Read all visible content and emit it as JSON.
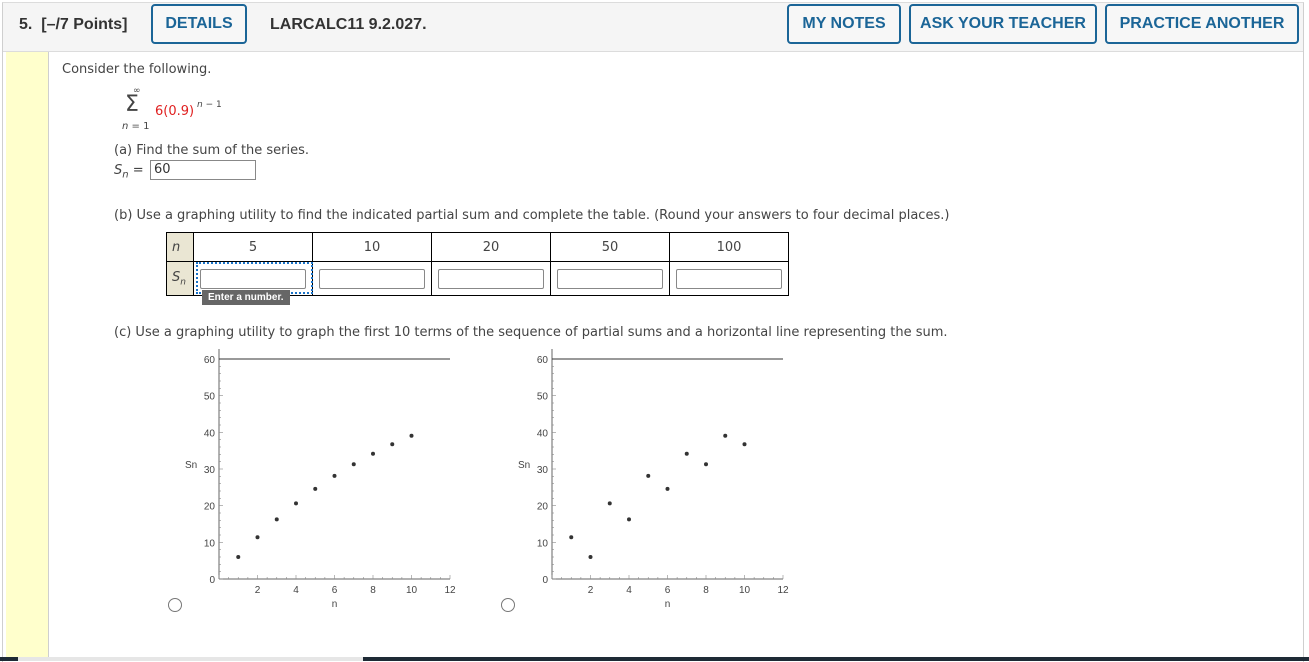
{
  "header": {
    "question_number": "5.",
    "points": "[–/7 Points]",
    "details_label": "DETAILS",
    "question_id": "LARCALC11 9.2.027.",
    "my_notes_label": "MY NOTES",
    "ask_teacher_label": "ASK YOUR TEACHER",
    "practice_another_label": "PRACTICE ANOTHER"
  },
  "colors": {
    "accent": "#1b6597",
    "highlight_red": "#e02020",
    "left_bar": "#ffffcc"
  },
  "problem": {
    "intro": "Consider the following.",
    "series": {
      "upper": "∞",
      "sigma": "Σ",
      "lower": "n = 1",
      "term_coefficient": "6(0.9)",
      "exponent": "n − 1"
    },
    "part_a": {
      "prompt": "(a) Find the sum of the series.",
      "label_var": "S",
      "label_sub": "n",
      "equals": "=",
      "value": "60"
    },
    "part_b": {
      "prompt": "(b) Use a graphing utility to find the indicated partial sum and complete the table. (Round your answers to four decimal places.)",
      "row_header_n": "n",
      "row_header_s": "S",
      "row_header_s_sub": "n",
      "columns": [
        "5",
        "10",
        "20",
        "50",
        "100"
      ],
      "values": [
        "",
        "",
        "",
        "",
        ""
      ],
      "tooltip": "Enter a number."
    },
    "part_c": {
      "prompt": "(c) Use a graphing utility to graph the first 10 terms of the sequence of partial sums and a horizontal line representing the sum."
    }
  },
  "chart_data": [
    {
      "type": "scatter",
      "title": "",
      "xlabel": "n",
      "ylabel": "Sn",
      "xlim": [
        0,
        12
      ],
      "ylim": [
        0,
        60
      ],
      "xticks": [
        "2",
        "4",
        "6",
        "8",
        "10",
        "12"
      ],
      "yticks": [
        "0",
        "10",
        "20",
        "30",
        "40",
        "50",
        "60"
      ],
      "horizontal_line": 60,
      "x": [
        1,
        2,
        3,
        4,
        5,
        6,
        7,
        8,
        9,
        10
      ],
      "y": [
        6,
        11.4,
        16.26,
        20.634,
        24.571,
        28.113,
        31.302,
        34.172,
        36.755,
        39.079
      ],
      "selected": false
    },
    {
      "type": "scatter",
      "title": "",
      "xlabel": "n",
      "ylabel": "Sn",
      "xlim": [
        0,
        12
      ],
      "ylim": [
        0,
        60
      ],
      "xticks": [
        "2",
        "4",
        "6",
        "8",
        "10",
        "12"
      ],
      "yticks": [
        "0",
        "10",
        "20",
        "30",
        "40",
        "50",
        "60"
      ],
      "horizontal_line": 60,
      "x": [
        1,
        2,
        3,
        4,
        5,
        6,
        7,
        8,
        9,
        10
      ],
      "y": [
        11.4,
        6,
        20.634,
        16.26,
        28.113,
        24.571,
        34.172,
        31.302,
        39.079,
        36.755
      ],
      "selected": false
    }
  ]
}
